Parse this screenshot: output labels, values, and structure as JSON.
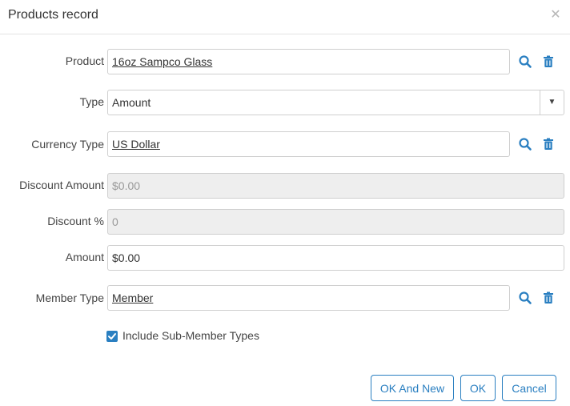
{
  "dialog": {
    "title": "Products record"
  },
  "fields": {
    "product": {
      "label": "Product",
      "value": "16oz Sampco Glass"
    },
    "type": {
      "label": "Type",
      "value": "Amount"
    },
    "currency_type": {
      "label": "Currency Type",
      "value": "US Dollar"
    },
    "discount_amount": {
      "label": "Discount Amount",
      "value": "$0.00"
    },
    "discount_percent": {
      "label": "Discount %",
      "value": "0"
    },
    "amount": {
      "label": "Amount",
      "value": "$0.00"
    },
    "member_type": {
      "label": "Member Type",
      "value": "Member"
    }
  },
  "include_sub_member_types": {
    "label": "Include Sub-Member Types",
    "checked": true
  },
  "buttons": {
    "ok_and_new": "OK And New",
    "ok": "OK",
    "cancel": "Cancel"
  },
  "colors": {
    "accent": "#2a7fc1",
    "disabled_bg": "#eeeeee",
    "border": "#cfcfcf"
  },
  "icons": {
    "close": "close-icon",
    "search": "search-icon",
    "delete": "trash-icon",
    "dropdown": "caret-down-icon",
    "checkbox": "check-icon"
  }
}
